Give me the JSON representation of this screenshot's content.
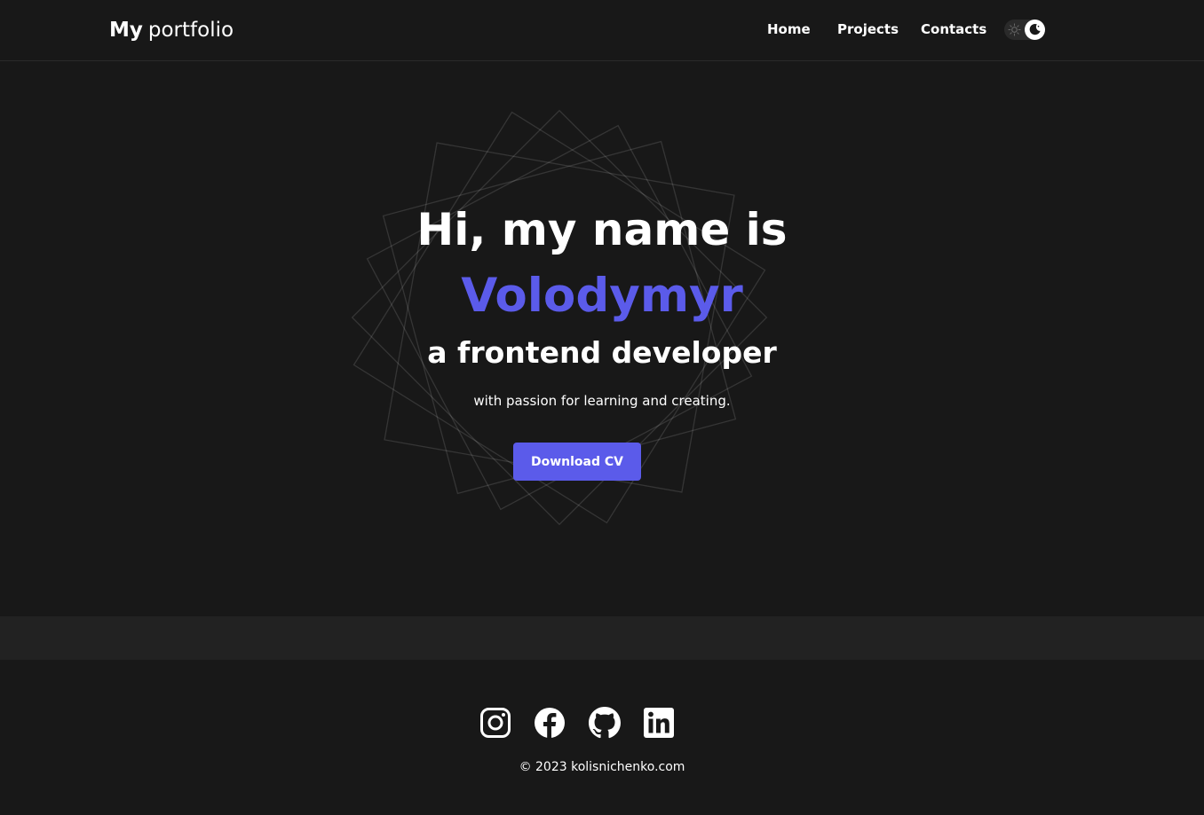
{
  "header": {
    "logo_bold": "My",
    "logo_light": "portfolio",
    "nav": [
      {
        "label": "Home"
      },
      {
        "label": "Projects"
      },
      {
        "label": "Contacts"
      }
    ],
    "theme_toggle": {
      "state": "dark",
      "icons": [
        "sun-icon",
        "moon-icon"
      ]
    }
  },
  "hero": {
    "title": "Hi, my name is",
    "name": "Volodymyr",
    "role": "a frontend developer",
    "tagline": "with passion for learning and creating.",
    "cta_label": "Download CV"
  },
  "footer": {
    "social": [
      {
        "icon": "instagram-icon"
      },
      {
        "icon": "facebook-icon"
      },
      {
        "icon": "github-icon"
      },
      {
        "icon": "linkedin-icon"
      }
    ],
    "copyright": "© 2023 kolisnichenko.com"
  },
  "colors": {
    "background": "#181818",
    "band": "#222222",
    "accent": "#5b5bea",
    "text": "#ffffff"
  }
}
